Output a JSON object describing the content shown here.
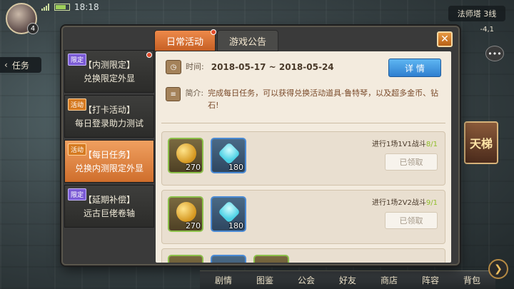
{
  "hud": {
    "time": "18:18",
    "player_level": "4",
    "server": "法师塔 3线",
    "coords": "-4,1",
    "task_tab": "任务",
    "chat": "•••",
    "tianti": "天梯"
  },
  "bottom_nav": [
    "剧情",
    "图鉴",
    "公会",
    "好友",
    "商店",
    "阵容",
    "背包"
  ],
  "dialog": {
    "tabs": [
      {
        "label": "日常活动",
        "active": true
      },
      {
        "label": "游戏公告",
        "active": false
      }
    ],
    "close_label": "✕",
    "sidebar": [
      {
        "tag": "限定",
        "tag_type": "limited",
        "title": "【内测限定】",
        "subtitle": "兑换限定外显",
        "active": false,
        "reddot": true
      },
      {
        "tag": "活动",
        "tag_type": "activity",
        "title": "【打卡活动】",
        "subtitle": "每日登录助力测试",
        "active": false,
        "reddot": false
      },
      {
        "tag": "活动",
        "tag_type": "activity",
        "title": "【每日任务】",
        "subtitle": "兑换内测限定外显",
        "active": true,
        "reddot": false
      },
      {
        "tag": "限定",
        "tag_type": "limited",
        "title": "【延期补偿】",
        "subtitle": "远古巨佬卷轴",
        "active": false,
        "reddot": false
      }
    ],
    "time_label": "时间:",
    "time_value": "2018-05-17 ~ 2018-05-24",
    "details_label": "详 情",
    "desc_label": "简介:",
    "desc_text": "完成每日任务，可以获得兑换活动道具-鲁特琴，以及超多金币、钻石!",
    "tasks": [
      {
        "desc": "进行1场1V1战斗",
        "progress": "8/1",
        "rewards": [
          {
            "type": "coin",
            "count": "270"
          },
          {
            "type": "gem",
            "count": "180"
          }
        ],
        "button": "已领取"
      },
      {
        "desc": "进行1场2V2战斗",
        "progress": "9/1",
        "rewards": [
          {
            "type": "coin",
            "count": "270"
          },
          {
            "type": "gem",
            "count": "180"
          }
        ],
        "button": "已领取"
      }
    ]
  }
}
